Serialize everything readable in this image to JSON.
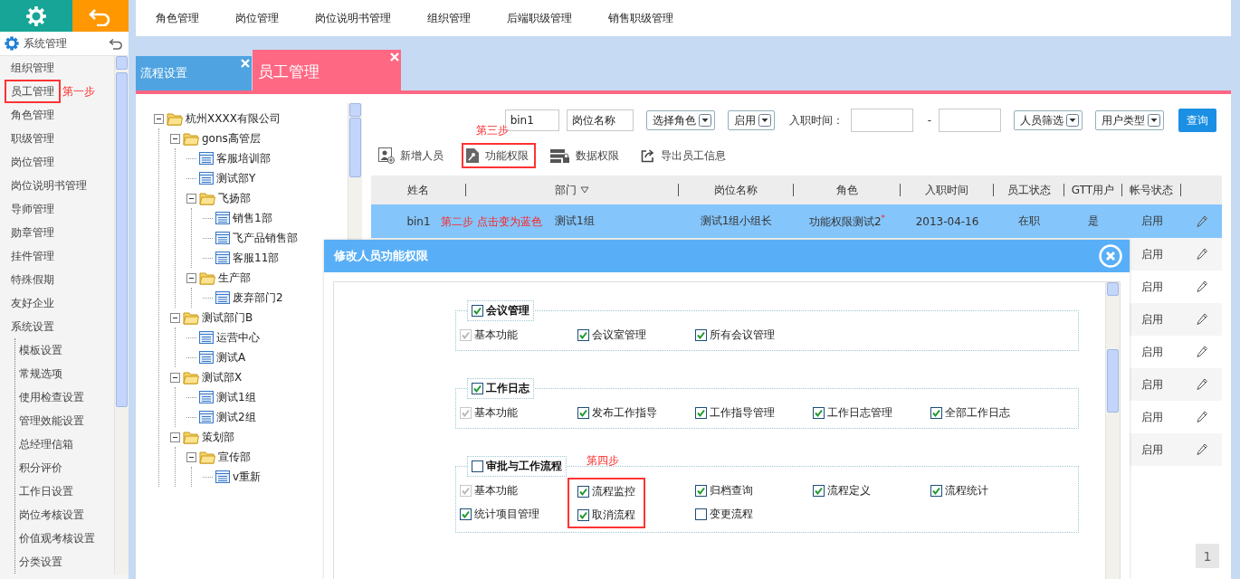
{
  "sidebar": {
    "title": "系统管理",
    "items": [
      {
        "label": "组织管理"
      },
      {
        "label": "员工管理",
        "annotation": "第一步"
      },
      {
        "label": "角色管理"
      },
      {
        "label": "职级管理"
      },
      {
        "label": "岗位管理"
      },
      {
        "label": "岗位说明书管理"
      },
      {
        "label": "导师管理"
      },
      {
        "label": "勋章管理"
      },
      {
        "label": "挂件管理"
      },
      {
        "label": "特殊假期"
      },
      {
        "label": "友好企业"
      },
      {
        "label": "系统设置",
        "children": [
          {
            "label": "模板设置"
          },
          {
            "label": "常规选项"
          },
          {
            "label": "使用检查设置"
          },
          {
            "label": "管理效能设置"
          },
          {
            "label": "总经理信箱"
          },
          {
            "label": "积分评价"
          },
          {
            "label": "工作日设置"
          },
          {
            "label": "岗位考核设置"
          },
          {
            "label": "价值观考核设置"
          },
          {
            "label": "分类设置"
          }
        ]
      }
    ]
  },
  "top_nav": [
    "角色管理",
    "岗位管理",
    "岗位说明书管理",
    "组织管理",
    "后端职级管理",
    "销售职级管理"
  ],
  "tabs": [
    {
      "label": "流程设置",
      "selected": false
    },
    {
      "label": "员工管理",
      "selected": true
    }
  ],
  "tree": [
    {
      "label": "杭州XXXX有限公司",
      "kind": "folder",
      "children": [
        {
          "label": "gons高管层",
          "kind": "folder",
          "children": [
            {
              "label": "客服培训部",
              "kind": "department"
            },
            {
              "label": "测试部Y",
              "kind": "department"
            },
            {
              "label": "飞扬部",
              "kind": "folder",
              "children": [
                {
                  "label": "销售1部",
                  "kind": "department"
                },
                {
                  "label": "飞产品销售部",
                  "kind": "department"
                },
                {
                  "label": "客服11部",
                  "kind": "department"
                }
              ]
            },
            {
              "label": "生产部",
              "kind": "folder",
              "children": [
                {
                  "label": "废弃部门2",
                  "kind": "department"
                }
              ]
            }
          ]
        },
        {
          "label": "测试部门B",
          "kind": "folder",
          "children": [
            {
              "label": "运营中心",
              "kind": "department"
            },
            {
              "label": "测试A",
              "kind": "department"
            }
          ]
        },
        {
          "label": "测试部X",
          "kind": "folder",
          "children": [
            {
              "label": "测试1组",
              "kind": "department"
            },
            {
              "label": "测试2组",
              "kind": "department"
            }
          ]
        },
        {
          "label": "策划部",
          "kind": "folder",
          "children": [
            {
              "label": "宣传部",
              "kind": "folder",
              "children": [
                {
                  "label": "v重新",
                  "kind": "department"
                }
              ]
            }
          ]
        }
      ]
    }
  ],
  "filters": [
    {
      "kind": "input",
      "value": "bin1"
    },
    {
      "kind": "input",
      "value": "岗位名称"
    },
    {
      "kind": "select",
      "value": "选择角色"
    },
    {
      "kind": "select",
      "value": "启用"
    },
    {
      "kind": "label",
      "text": "入职时间："
    },
    {
      "kind": "date"
    },
    {
      "kind": "label",
      "text": "-"
    },
    {
      "kind": "date"
    },
    {
      "kind": "select",
      "value": "人员筛选"
    },
    {
      "kind": "select",
      "value": "用户类型"
    },
    {
      "kind": "button",
      "text": "查询"
    }
  ],
  "toolbar": [
    {
      "label": "新增人员"
    },
    {
      "label": "功能权限",
      "annotation": "第三步"
    },
    {
      "label": "数据权限"
    },
    {
      "label": "导出员工信息"
    }
  ],
  "table": {
    "columns": [
      {
        "label": "姓名",
        "sortable": false
      },
      {
        "label": "部门",
        "sortable": true
      },
      {
        "label": "岗位名称",
        "sortable": false
      },
      {
        "label": "角色",
        "sortable": false
      },
      {
        "label": "入职时间",
        "sortable": false
      },
      {
        "label": "员工状态",
        "sortable": false
      },
      {
        "label": "GTT用户",
        "sortable": false
      },
      {
        "label": "帐号状态",
        "sortable": false
      }
    ],
    "rows": [
      {
        "selected": true,
        "name": "bin1",
        "annotation": "第二步 点击变为蓝色",
        "department": "测试1组",
        "position": "测试1组小组长",
        "role": "功能权限测试2$^{*}$",
        "hire_date": "2013-04-16",
        "employee_status": "在职",
        "gtt_user": "是",
        "account_status": "启用"
      },
      {
        "selected": false,
        "account_status": "启用"
      },
      {
        "selected": false,
        "account_status": "启用"
      },
      {
        "selected": false,
        "account_status": "启用"
      },
      {
        "selected": false,
        "account_status": "启用"
      },
      {
        "selected": false,
        "account_status": "启用"
      },
      {
        "selected": false,
        "account_status": "启用"
      },
      {
        "selected": false,
        "account_status": "启用"
      }
    ]
  },
  "pagination": {
    "current": "1"
  },
  "modal": {
    "title": "修改人员功能权限",
    "sections": [
      {
        "label": "会议管理",
        "checked": true,
        "items": [
          {
            "label": "基本功能",
            "checked": true,
            "disabled": true
          },
          {
            "label": "会议室管理",
            "checked": true,
            "disabled": false
          },
          {
            "label": "所有会议管理",
            "checked": true,
            "disabled": false
          }
        ]
      },
      {
        "label": "工作日志",
        "checked": true,
        "items": [
          {
            "label": "基本功能",
            "checked": true,
            "disabled": true
          },
          {
            "label": "发布工作指导",
            "checked": true,
            "disabled": false
          },
          {
            "label": "工作指导管理",
            "checked": true,
            "disabled": false
          },
          {
            "label": "工作日志管理",
            "checked": true,
            "disabled": false
          },
          {
            "label": "全部工作日志",
            "checked": true,
            "disabled": false
          }
        ]
      },
      {
        "label": "审批与工作流程",
        "checked": false,
        "annotation": "第四步",
        "items": [
          {
            "label": "基本功能",
            "checked": true,
            "disabled": true,
            "highlighted": false
          },
          {
            "label": "流程监控",
            "checked": true,
            "disabled": false,
            "highlighted": true
          },
          {
            "label": "归档查询",
            "checked": true,
            "disabled": false,
            "highlighted": false
          },
          {
            "label": "流程定义",
            "checked": true,
            "disabled": false,
            "highlighted": false
          },
          {
            "label": "流程统计",
            "checked": true,
            "disabled": false,
            "highlighted": false
          },
          {
            "label": "统计项目管理",
            "checked": true,
            "disabled": false,
            "highlighted": false
          },
          {
            "label": "取消流程",
            "checked": true,
            "disabled": false,
            "highlighted": true
          },
          {
            "label": "变更流程",
            "checked": false,
            "disabled": false,
            "highlighted": false
          }
        ]
      }
    ]
  }
}
